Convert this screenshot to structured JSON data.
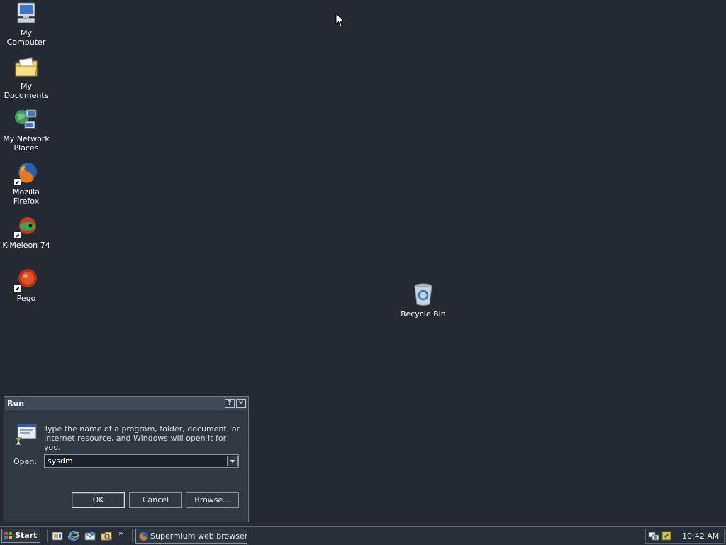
{
  "desktop": {
    "icons": [
      {
        "label": "My Computer",
        "icon": "computer-icon"
      },
      {
        "label": "My Documents",
        "icon": "folder-documents-icon"
      },
      {
        "label": "My Network Places",
        "icon": "network-icon"
      },
      {
        "label": "Mozilla Firefox",
        "icon": "firefox-icon",
        "shortcut": true
      },
      {
        "label": "K-Meleon 74",
        "icon": "kmeleon-icon",
        "shortcut": true
      },
      {
        "label": "Pego",
        "icon": "pego-icon",
        "shortcut": true
      },
      {
        "label": "Recycle Bin",
        "icon": "recycle-bin-icon"
      }
    ]
  },
  "run_dialog": {
    "title": "Run",
    "help_glyph": "?",
    "close_glyph": "✕",
    "description": "Type the name of a program, folder, document, or Internet resource, and Windows will open it for you.",
    "open_label": "Open:",
    "open_value": "sysdm",
    "buttons": {
      "ok": "OK",
      "cancel": "Cancel",
      "browse": "Browse..."
    }
  },
  "taskbar": {
    "start_label": "Start",
    "quick_launch": [
      "show-desktop-icon",
      "internet-explorer-icon",
      "outlook-express-icon",
      "explorer-icon"
    ],
    "overflow_glyph": "»",
    "task_label": "Supermium web browser -...",
    "clock": "10:42 AM"
  },
  "colors": {
    "desktop_bg": "#232a33",
    "dialog_bg": "#2e3944",
    "title_bg": "#3e4b59"
  }
}
